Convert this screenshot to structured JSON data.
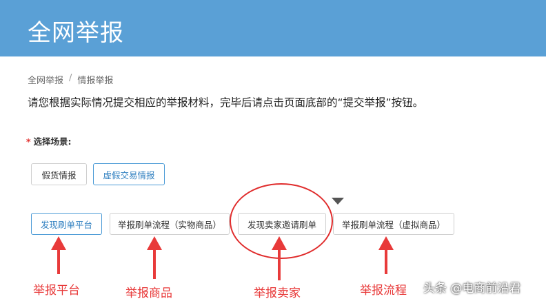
{
  "header": {
    "title": "全网举报"
  },
  "breadcrumb": {
    "home": "全网举报",
    "separator": "/",
    "current": "情报举报"
  },
  "instruction": "请您根据实际情况提交相应的举报材料，完毕后请点击页面底部的“提交举报”按钮。",
  "scene": {
    "required_mark": "*",
    "label": "选择场景:",
    "types": [
      "假货情报",
      "虚假交易情报"
    ],
    "subtypes": [
      "发现刷单平台",
      "举报刷单流程（实物商品）",
      "发现卖家邀请刷单",
      "举报刷单流程（虚拟商品）"
    ]
  },
  "annotations": [
    "举报平台",
    "举报商品",
    "举报卖家",
    "举报流程"
  ],
  "watermark": "头条 @电商前沿君",
  "colors": {
    "header_bg": "#5aa0d6",
    "active_border": "#4a9ad6",
    "annotation": "#e83a3a"
  }
}
